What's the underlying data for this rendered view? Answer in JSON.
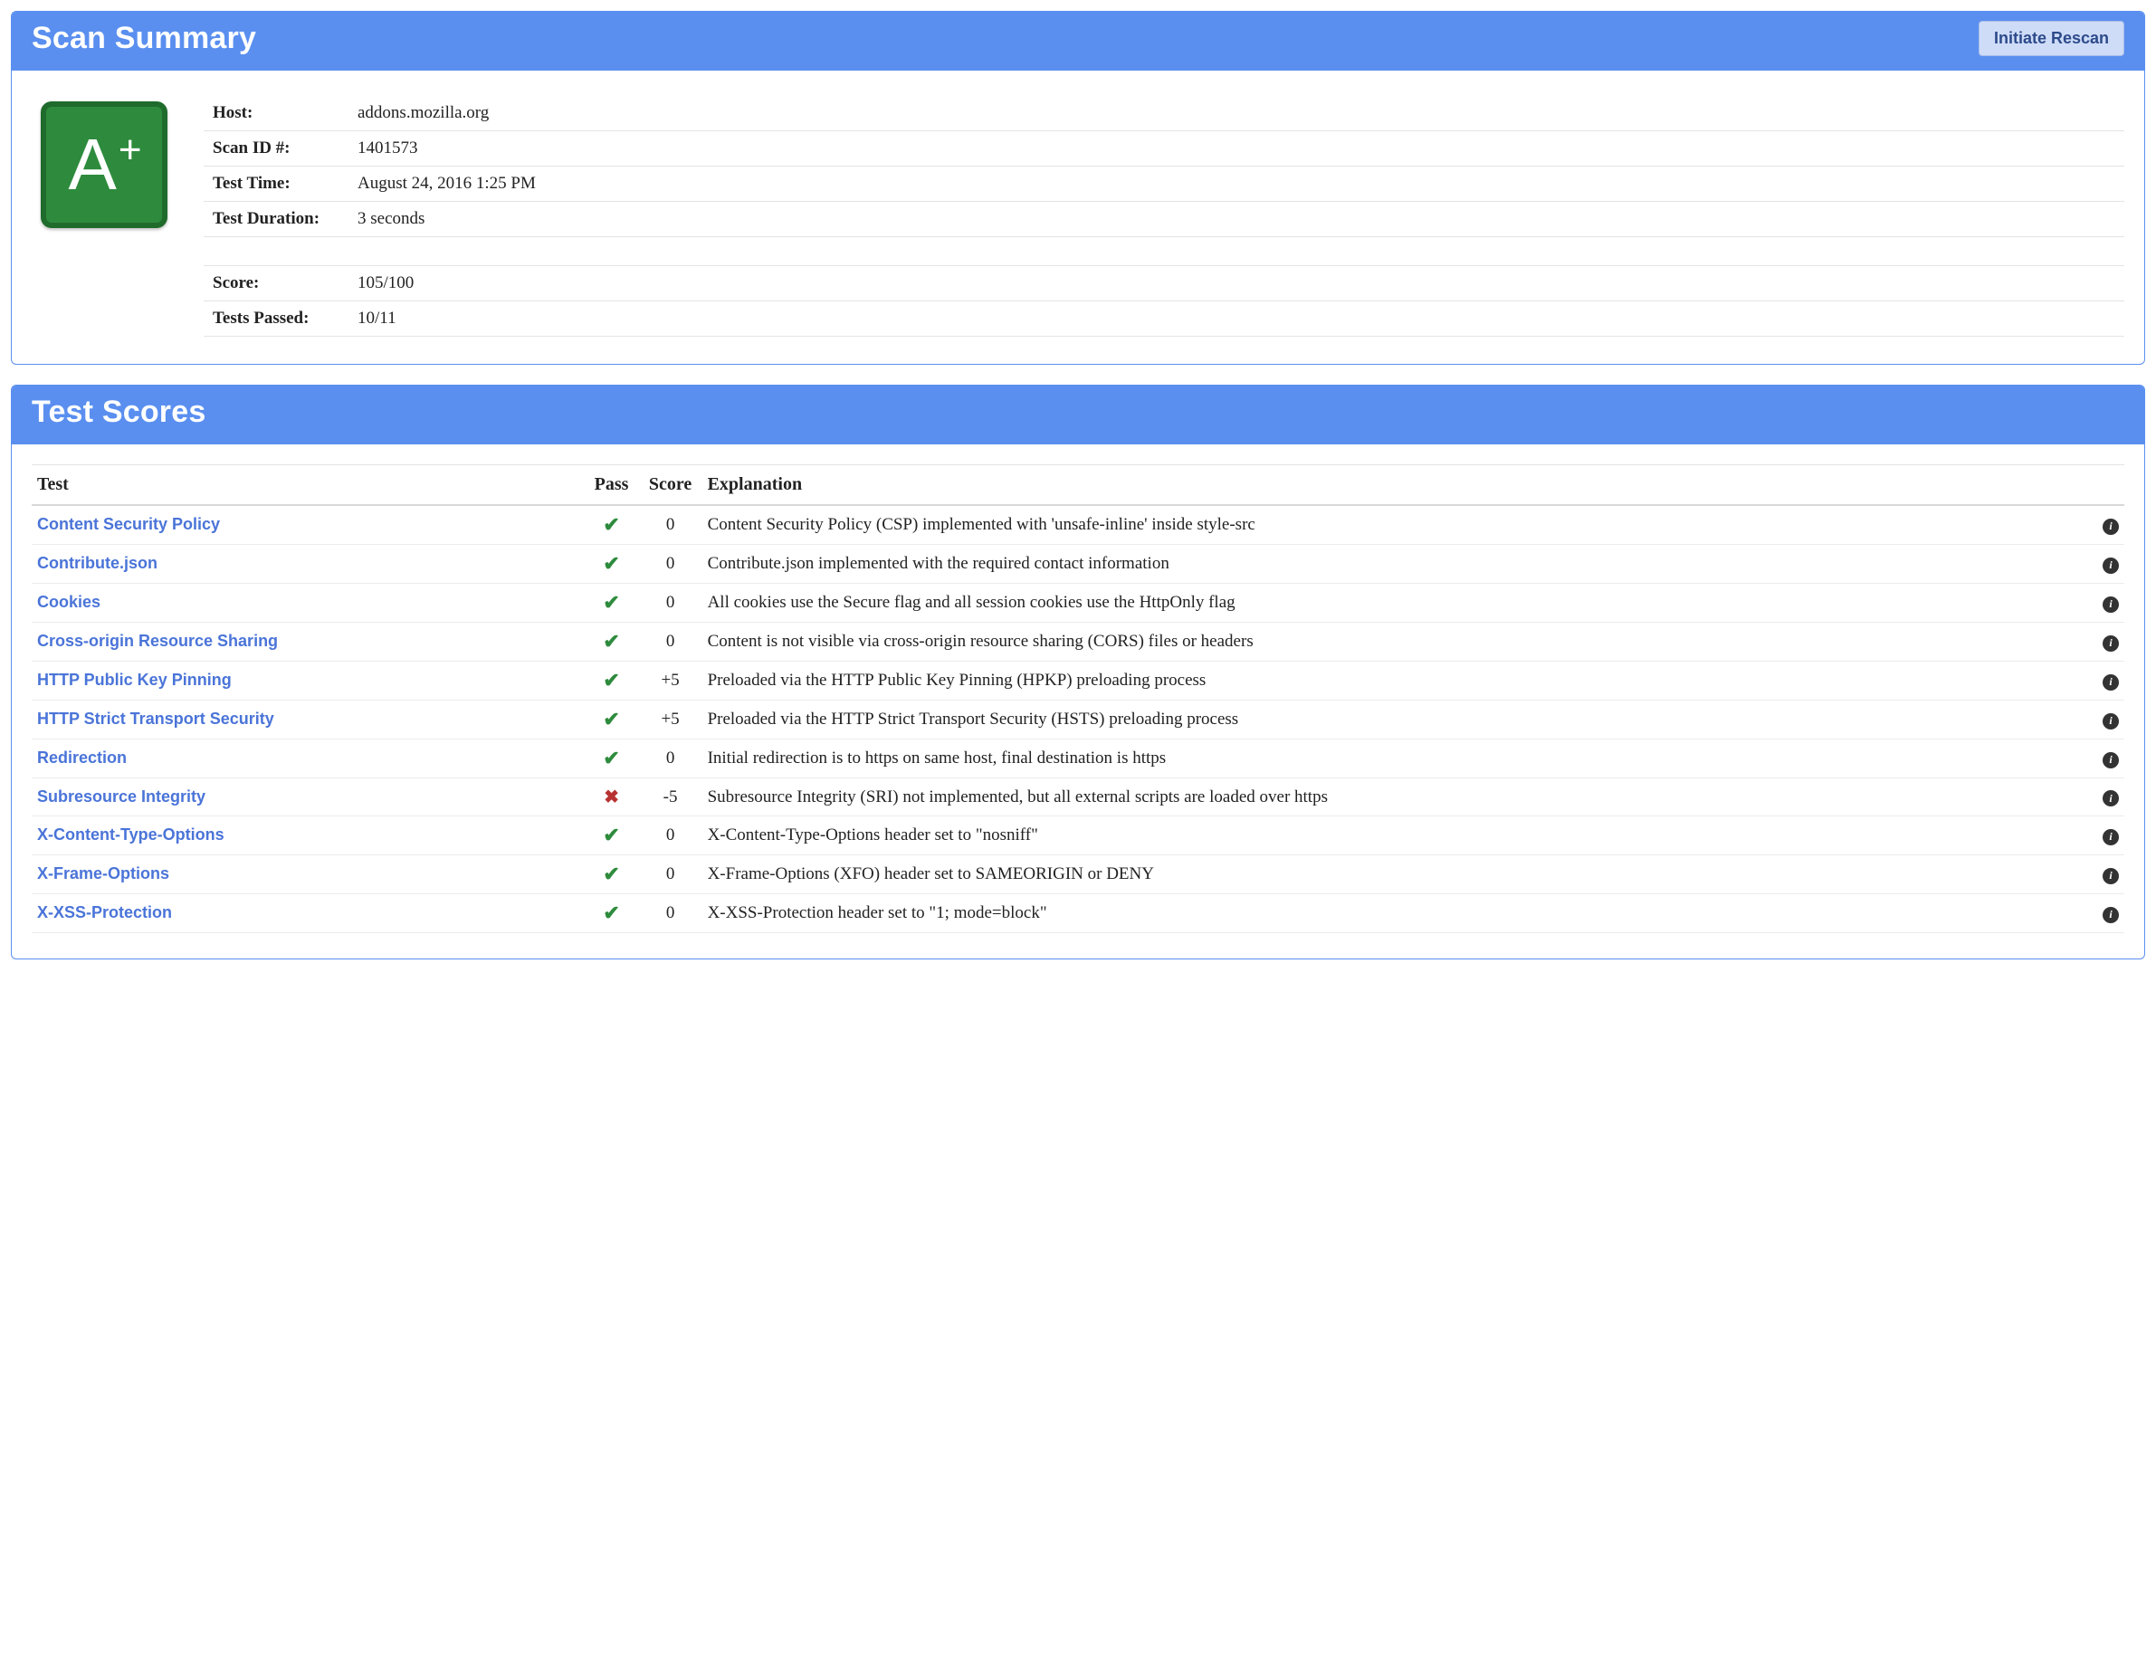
{
  "summary": {
    "title": "Scan Summary",
    "rescan_label": "Initiate Rescan",
    "grade": {
      "letter": "A",
      "suffix": "+"
    },
    "rows": {
      "host_label": "Host:",
      "host_value": "addons.mozilla.org",
      "scanid_label": "Scan ID #:",
      "scanid_value": "1401573",
      "testtime_label": "Test Time:",
      "testtime_value": "August 24, 2016 1:25 PM",
      "duration_label": "Test Duration:",
      "duration_value": "3 seconds",
      "score_label": "Score:",
      "score_value": "105/100",
      "passed_label": "Tests Passed:",
      "passed_value": "10/11"
    }
  },
  "scores": {
    "title": "Test Scores",
    "headers": {
      "test": "Test",
      "pass": "Pass",
      "score": "Score",
      "explanation": "Explanation"
    },
    "rows": [
      {
        "test": "Content Security Policy",
        "pass": true,
        "score": "0",
        "explanation": "Content Security Policy (CSP) implemented with 'unsafe-inline' inside style-src"
      },
      {
        "test": "Contribute.json",
        "pass": true,
        "score": "0",
        "explanation": "Contribute.json implemented with the required contact information"
      },
      {
        "test": "Cookies",
        "pass": true,
        "score": "0",
        "explanation": "All cookies use the Secure flag and all session cookies use the HttpOnly flag"
      },
      {
        "test": "Cross-origin Resource Sharing",
        "pass": true,
        "score": "0",
        "explanation": "Content is not visible via cross-origin resource sharing (CORS) files or headers"
      },
      {
        "test": "HTTP Public Key Pinning",
        "pass": true,
        "score": "+5",
        "explanation": "Preloaded via the HTTP Public Key Pinning (HPKP) preloading process"
      },
      {
        "test": "HTTP Strict Transport Security",
        "pass": true,
        "score": "+5",
        "explanation": "Preloaded via the HTTP Strict Transport Security (HSTS) preloading process"
      },
      {
        "test": "Redirection",
        "pass": true,
        "score": "0",
        "explanation": "Initial redirection is to https on same host, final destination is https"
      },
      {
        "test": "Subresource Integrity",
        "pass": false,
        "score": "-5",
        "explanation": "Subresource Integrity (SRI) not implemented, but all external scripts are loaded over https"
      },
      {
        "test": "X-Content-Type-Options",
        "pass": true,
        "score": "0",
        "explanation": "X-Content-Type-Options header set to \"nosniff\""
      },
      {
        "test": "X-Frame-Options",
        "pass": true,
        "score": "0",
        "explanation": "X-Frame-Options (XFO) header set to SAMEORIGIN or DENY"
      },
      {
        "test": "X-XSS-Protection",
        "pass": true,
        "score": "0",
        "explanation": "X-XSS-Protection header set to \"1; mode=block\""
      }
    ]
  }
}
